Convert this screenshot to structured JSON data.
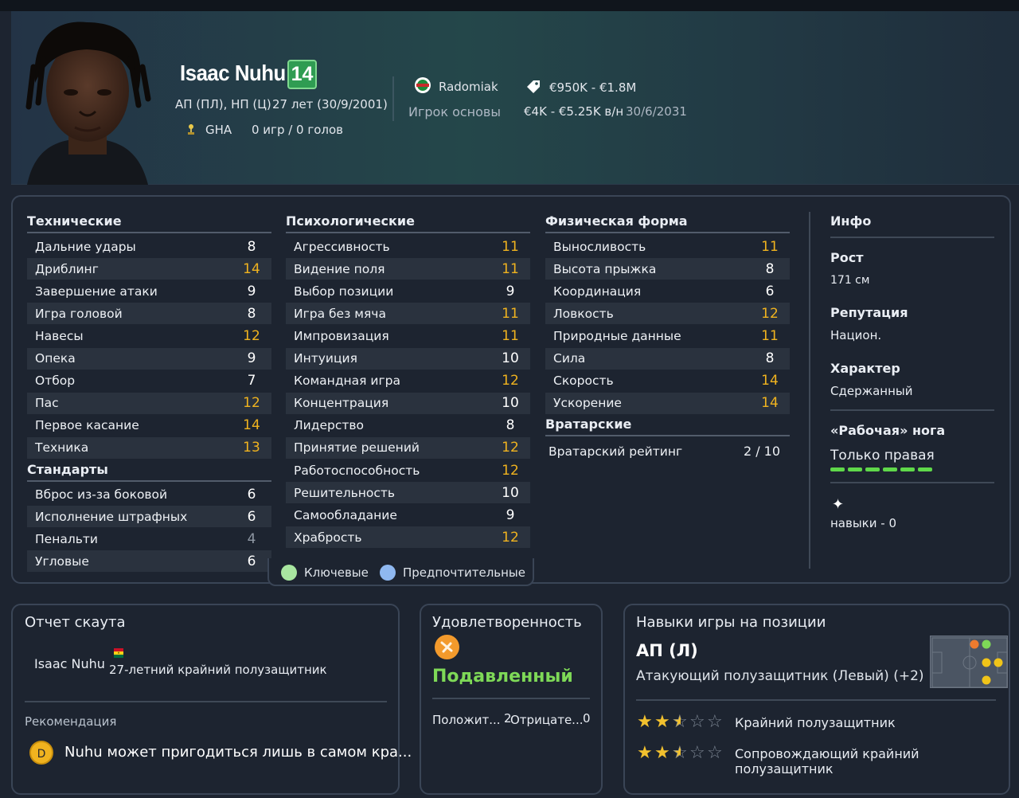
{
  "header": {
    "player_name": "Isaac Nuhu",
    "shirt_number": "14",
    "positions": "АП (ПЛ), НП (Ц)",
    "age_dob": "27 лет (30/9/2001)",
    "nationality": "GHA",
    "apps_goals": "0 игр / 0 голов",
    "club": "Radomiak",
    "squad_status": "Игрок основы",
    "value": "€950K - €1.8M",
    "wage": "€4K - €5.25K в/н",
    "contract_end": "30/6/2031"
  },
  "technical": {
    "title": "Технические",
    "rows": [
      {
        "label": "Дальние удары",
        "value": "8"
      },
      {
        "label": "Дриблинг",
        "value": "14"
      },
      {
        "label": "Завершение атаки",
        "value": "9"
      },
      {
        "label": "Игра головой",
        "value": "8"
      },
      {
        "label": "Навесы",
        "value": "12"
      },
      {
        "label": "Опека",
        "value": "9"
      },
      {
        "label": "Отбор",
        "value": "7"
      },
      {
        "label": "Пас",
        "value": "12"
      },
      {
        "label": "Первое касание",
        "value": "14"
      },
      {
        "label": "Техника",
        "value": "13"
      }
    ]
  },
  "set_pieces": {
    "title": "Стандарты",
    "rows": [
      {
        "label": "Вброс из-за боковой",
        "value": "6"
      },
      {
        "label": "Исполнение штрафных",
        "value": "6"
      },
      {
        "label": "Пенальти",
        "value": "4"
      },
      {
        "label": "Угловые",
        "value": "6"
      }
    ]
  },
  "mental": {
    "title": "Психологические",
    "rows": [
      {
        "label": "Агрессивность",
        "value": "11"
      },
      {
        "label": "Видение поля",
        "value": "11"
      },
      {
        "label": "Выбор позиции",
        "value": "9"
      },
      {
        "label": "Игра без мяча",
        "value": "11"
      },
      {
        "label": "Импровизация",
        "value": "11"
      },
      {
        "label": "Интуиция",
        "value": "10"
      },
      {
        "label": "Командная игра",
        "value": "12"
      },
      {
        "label": "Концентрация",
        "value": "10"
      },
      {
        "label": "Лидерство",
        "value": "8"
      },
      {
        "label": "Принятие решений",
        "value": "12"
      },
      {
        "label": "Работоспособность",
        "value": "12"
      },
      {
        "label": "Решительность",
        "value": "10"
      },
      {
        "label": "Самообладание",
        "value": "9"
      },
      {
        "label": "Храбрость",
        "value": "12"
      }
    ]
  },
  "physical": {
    "title": "Физическая форма",
    "rows": [
      {
        "label": "Выносливость",
        "value": "11"
      },
      {
        "label": "Высота прыжка",
        "value": "8"
      },
      {
        "label": "Координация",
        "value": "6"
      },
      {
        "label": "Ловкость",
        "value": "12"
      },
      {
        "label": "Природные данные",
        "value": "11"
      },
      {
        "label": "Сила",
        "value": "8"
      },
      {
        "label": "Скорость",
        "value": "14"
      },
      {
        "label": "Ускорение",
        "value": "14"
      }
    ]
  },
  "goalkeeping": {
    "title": "Вратарские",
    "label": "Вратарский рейтинг",
    "value": "2 / 10"
  },
  "info": {
    "title": "Инфо",
    "height_label": "Рост",
    "height_value": "171 см",
    "reputation_label": "Репутация",
    "reputation_value": "Национ.",
    "personality_label": "Характер",
    "personality_value": "Сдержанный",
    "foot_label": "«Рабочая» нога",
    "foot_value": "Только правая",
    "traits_value": "навыки - 0"
  },
  "legend": {
    "key_label": "Ключевые",
    "preferred_label": "Предпочтительные",
    "key_color": "#a8e6a0",
    "preferred_color": "#8fb8f0"
  },
  "scout": {
    "title": "Отчет скаута",
    "player_name": "Isaac Nuhu",
    "description": "27-летний крайний полузащитник",
    "recommendation_label": "Рекомендация",
    "grade": "D",
    "recommendation": "Nuhu может пригодиться лишь в самом кра..."
  },
  "happiness": {
    "title": "Удовлетворенность",
    "status": "Подавленный",
    "positive_label": "Положит...",
    "positive_count": "2",
    "negative_label": "Отрицате...",
    "negative_count": "0"
  },
  "role": {
    "title": "Навыки игры на позиции",
    "position": "АП (Л)",
    "role_name": "Атакующий полузащитник (Левый) (+2)",
    "roles": [
      {
        "name": "Крайний полузащитник",
        "stars": 2.5
      },
      {
        "name": "Сопровождающий крайний полузащитник",
        "stars": 2.5
      }
    ]
  },
  "colors": {
    "accent_green": "#2f9c52",
    "highlight_value": "#f0b31f",
    "status_green": "#7ed957"
  }
}
